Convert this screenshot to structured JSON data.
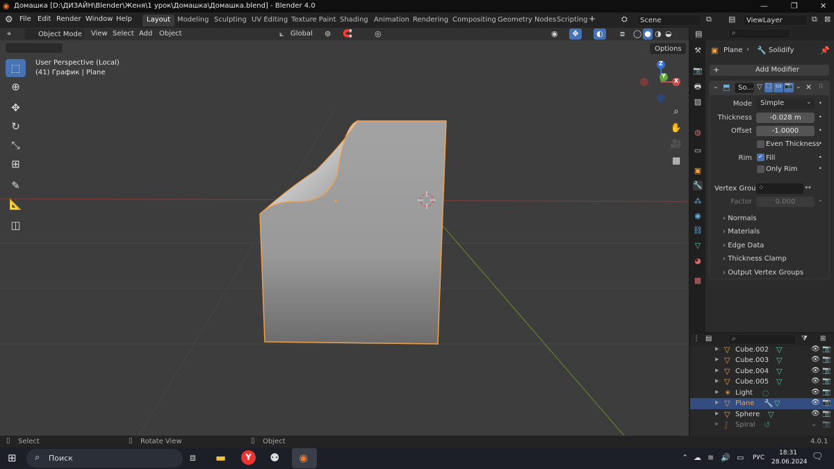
{
  "window": {
    "title": "Домашка [D:\\ДИЗАЙН\\Blender\\Женя\\1 урок\\Домашка\\Домашка.blend] - Blender 4.0"
  },
  "menu": {
    "file": "File",
    "edit": "Edit",
    "render": "Render",
    "window": "Window",
    "help": "Help"
  },
  "workspaces": [
    "Layout",
    "Modeling",
    "Sculpting",
    "UV Editing",
    "Texture Paint",
    "Shading",
    "Animation",
    "Rendering",
    "Compositing",
    "Geometry Nodes",
    "Scripting"
  ],
  "scene": {
    "name": "Scene",
    "view_layer": "ViewLayer"
  },
  "viewport": {
    "mode": "Object Mode",
    "view": "View",
    "select": "Select",
    "add": "Add",
    "object": "Object",
    "transform_orientation": "Global",
    "options": "Options",
    "perspective": "User Perspective (Local)",
    "context": "(41) График | Plane"
  },
  "gizmo": {
    "z": "Z",
    "y": "Y",
    "x": "X"
  },
  "properties": {
    "breadcrumb_object": "Plane",
    "breadcrumb_modifier": "Solidify",
    "add_modifier": "Add Modifier",
    "modifier_name": "So...",
    "mode_label": "Mode",
    "mode_value": "Simple",
    "thickness_label": "Thickness",
    "thickness_value": "-0.028 m",
    "offset_label": "Offset",
    "offset_value": "-1.0000",
    "even_thickness": "Even Thickness",
    "rim_label": "Rim",
    "fill": "Fill",
    "only_rim": "Only Rim",
    "vertex_group_label": "Vertex Group",
    "factor_label": "Factor",
    "factor_value": "0.000",
    "panels": [
      "Normals",
      "Materials",
      "Edge Data",
      "Thickness Clamp",
      "Output Vertex Groups"
    ]
  },
  "outliner": {
    "rows": [
      {
        "name": "Cube.002",
        "selected": false
      },
      {
        "name": "Cube.003",
        "selected": false
      },
      {
        "name": "Cube.004",
        "selected": false
      },
      {
        "name": "Cube.005",
        "selected": false
      },
      {
        "name": "Light",
        "selected": false
      },
      {
        "name": "Plane",
        "selected": true
      },
      {
        "name": "Sphere",
        "selected": false
      },
      {
        "name": "Spiral",
        "selected": false
      }
    ]
  },
  "statusbar": {
    "select": "Select",
    "rotate": "Rotate View",
    "object": "Object",
    "version": "4.0.1"
  },
  "taskbar": {
    "search": "Поиск",
    "lang": "РУС",
    "time": "18:31",
    "date": "28.06.2024"
  },
  "colors": {
    "accent": "#4772b3",
    "selection_orange": "#f0a04b",
    "viewport_bg": "#3d3d3d",
    "panel_bg": "#2b2b2b"
  }
}
